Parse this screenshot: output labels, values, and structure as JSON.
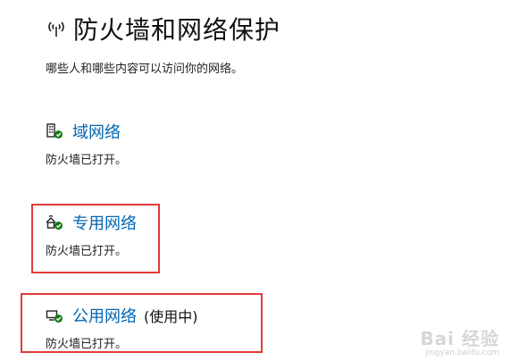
{
  "header": {
    "icon": "wifi-signal-icon",
    "title": "防火墙和网络保护",
    "subtitle": "哪些人和哪些内容可以访问你的网络。"
  },
  "networks": [
    {
      "icon": "domain-network-icon",
      "name": "域网络",
      "active_label": "",
      "status": "防火墙已打开。"
    },
    {
      "icon": "private-network-icon",
      "name": "专用网络",
      "active_label": "",
      "status": "防火墙已打开。"
    },
    {
      "icon": "public-network-icon",
      "name": "公用网络",
      "active_label": "(使用中)",
      "status": "防火墙已打开。"
    }
  ],
  "colors": {
    "link": "#0066b4",
    "check": "#107c10",
    "highlight": "#e23b3b"
  },
  "watermark": {
    "main": "Bai 经验",
    "sub": "jingyan.baidu.com"
  }
}
